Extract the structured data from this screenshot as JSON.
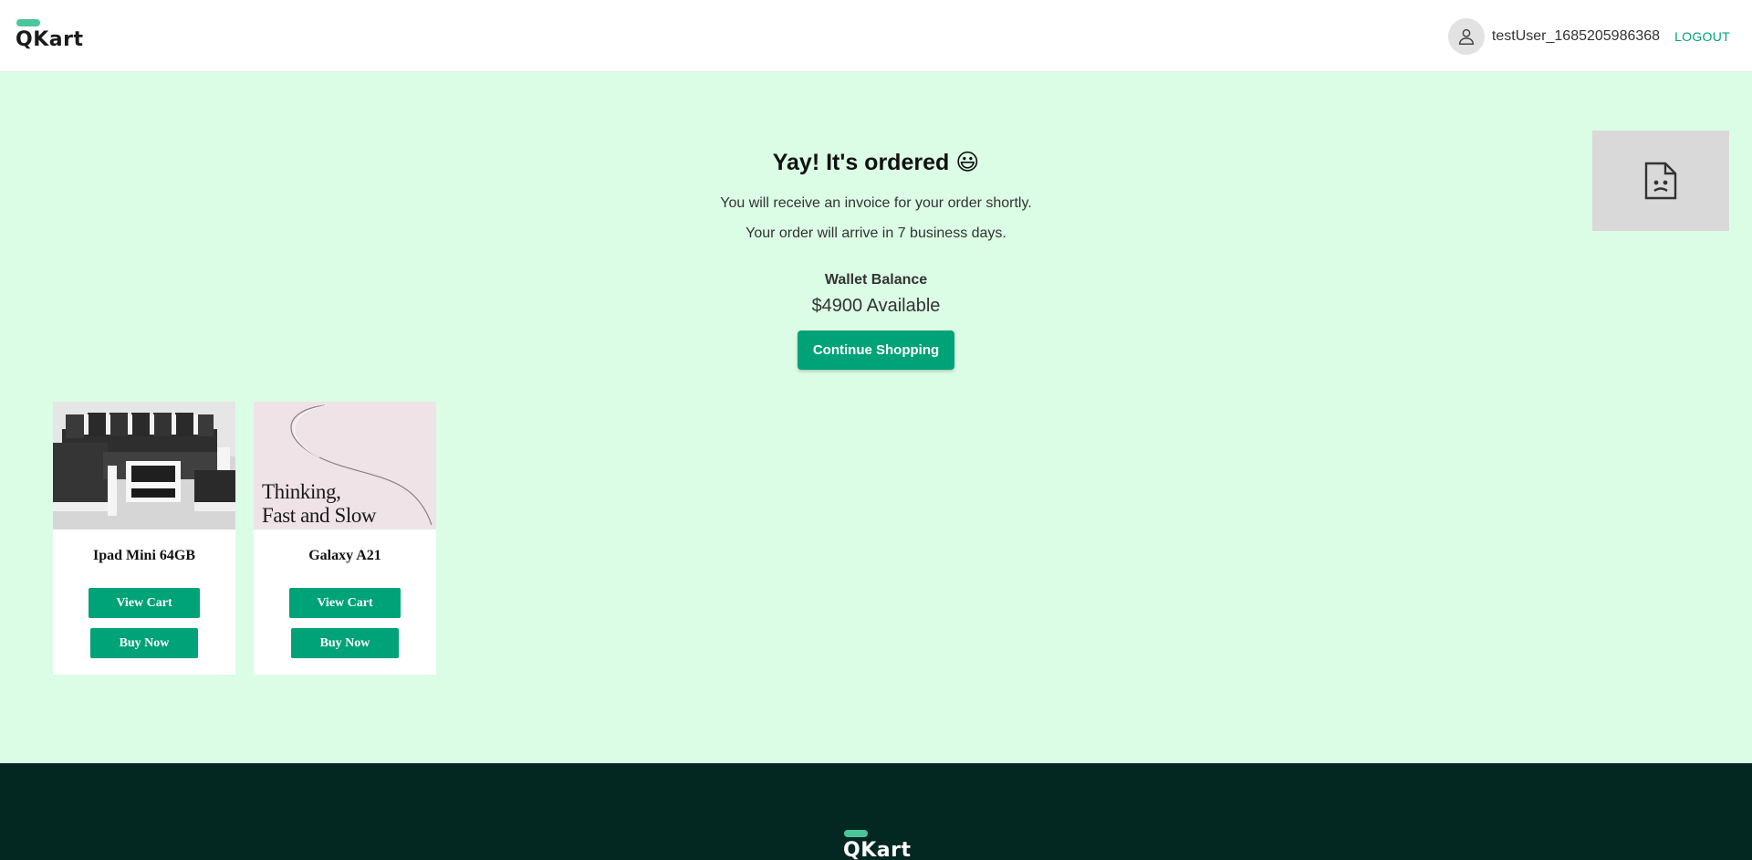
{
  "header": {
    "logo_text": "QKart",
    "username": "testUser_1685205986368",
    "logout_label": "LOGOUT"
  },
  "order": {
    "title": "Yay! It's ordered 😃",
    "invoice_note": "You will receive an invoice for your order shortly.",
    "arrival_note": "Your order will arrive in 7 business days.",
    "wallet_label": "Wallet Balance",
    "wallet_amount": "$4900 Available",
    "continue_label": "Continue Shopping"
  },
  "products": [
    {
      "name": "Ipad Mini 64GB",
      "view_label": "View Cart",
      "buy_label": "Buy Now",
      "image": "sofa-set"
    },
    {
      "name": "Galaxy A21",
      "view_label": "View Cart",
      "buy_label": "Buy Now",
      "image": "book-cover",
      "image_text": [
        "Thinking,",
        "Fast and Slow"
      ]
    }
  ],
  "footer": {
    "logo_text": "QKart"
  },
  "colors": {
    "accent": "#00a278",
    "page_bg": "#dbfde5",
    "footer_bg": "#032721",
    "logo_pill": "#4cc59a"
  }
}
